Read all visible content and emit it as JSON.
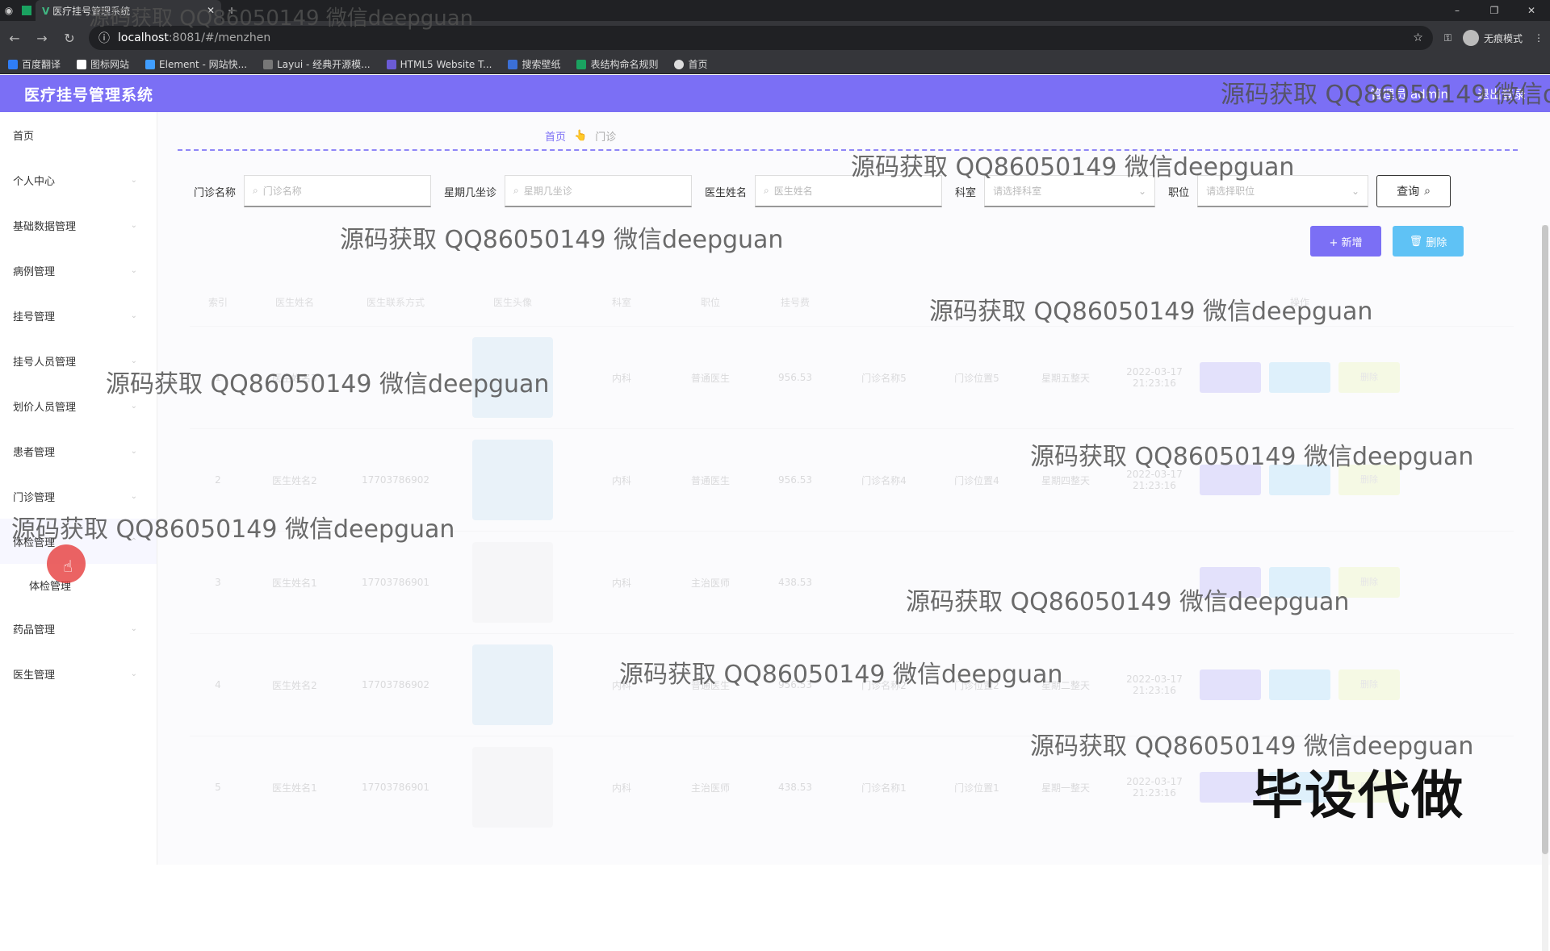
{
  "browser": {
    "tab_title": "医疗挂号管理系统",
    "new_tab": "+",
    "url_host": "localhost",
    "url_path": ":8081/#/menzhen",
    "incognito_label": "无痕模式",
    "bookmarks": [
      "百度翻译",
      "图标网站",
      "Element - 网站快...",
      "Layui - 经典开源模...",
      "HTML5 Website T...",
      "搜索壁纸",
      "表结构命名规则",
      "首页"
    ]
  },
  "app": {
    "title": "医疗挂号管理系统",
    "user": "管理员 admin",
    "logout": "退出登录"
  },
  "sidebar": {
    "items": [
      {
        "label": "首页"
      },
      {
        "label": "个人中心"
      },
      {
        "label": "基础数据管理"
      },
      {
        "label": "病例管理"
      },
      {
        "label": "挂号管理"
      },
      {
        "label": "挂号人员管理"
      },
      {
        "label": "划价人员管理"
      },
      {
        "label": "患者管理"
      },
      {
        "label": "门诊管理"
      },
      {
        "label": "体检管理"
      },
      {
        "label": "体检管理"
      },
      {
        "label": "药品管理"
      },
      {
        "label": "医生管理"
      }
    ]
  },
  "breadcrumb": {
    "home": "首页",
    "current": "门诊"
  },
  "filters": {
    "clinic_name_label": "门诊名称",
    "clinic_name_placeholder": "门诊名称",
    "weekday_label": "星期几坐诊",
    "weekday_placeholder": "星期几坐诊",
    "doctor_label": "医生姓名",
    "doctor_placeholder": "医生姓名",
    "dept_label": "科室",
    "dept_placeholder": "请选择科室",
    "position_label": "职位",
    "position_placeholder": "请选择职位",
    "query_button": "查询"
  },
  "actions": {
    "add": "+ 新增",
    "delete": "删除"
  },
  "table": {
    "headers": [
      "索引",
      "医生姓名",
      "医生联系方式",
      "医生头像",
      "科室",
      "职位",
      "挂号费",
      "",
      "",
      "",
      "",
      "操作"
    ],
    "rows": [
      {
        "index": "1",
        "name": "医生姓名3",
        "phone": "",
        "dept": "内科",
        "pos": "普通医生",
        "fee": "956.53",
        "clinic": "门诊名称5",
        "loc": "门诊位置5",
        "day": "星期五整天",
        "time": "2022-03-17 21:23:16",
        "photo": "blue"
      },
      {
        "index": "2",
        "name": "医生姓名2",
        "phone": "17703786902",
        "dept": "内科",
        "pos": "普通医生",
        "fee": "956.53",
        "clinic": "门诊名称4",
        "loc": "门诊位置4",
        "day": "星期四整天",
        "time": "2022-03-17 21:23:16",
        "photo": "blue"
      },
      {
        "index": "3",
        "name": "医生姓名1",
        "phone": "17703786901",
        "dept": "内科",
        "pos": "主治医师",
        "fee": "438.53",
        "clinic": "",
        "loc": "",
        "day": "",
        "time": "",
        "photo": "white"
      },
      {
        "index": "4",
        "name": "医生姓名2",
        "phone": "17703786902",
        "dept": "内科",
        "pos": "普通医生",
        "fee": "956.53",
        "clinic": "门诊名称2",
        "loc": "门诊位置2",
        "day": "星期二整天",
        "time": "2022-03-17 21:23:16",
        "photo": "blue"
      },
      {
        "index": "5",
        "name": "医生姓名1",
        "phone": "17703786901",
        "dept": "内科",
        "pos": "主治医师",
        "fee": "438.53",
        "clinic": "门诊名称1",
        "loc": "门诊位置1",
        "day": "星期一整天",
        "time": "2022-03-17 21:23:16",
        "photo": "white"
      }
    ]
  },
  "row_delete_label": "删除",
  "watermark_text": "源码获取 QQ86050149 微信deepguan",
  "stamp_text": "毕设代做",
  "colors": {
    "accent": "#7b6ff5",
    "secondary": "#5fc2f5",
    "warning": "#dff27a"
  }
}
